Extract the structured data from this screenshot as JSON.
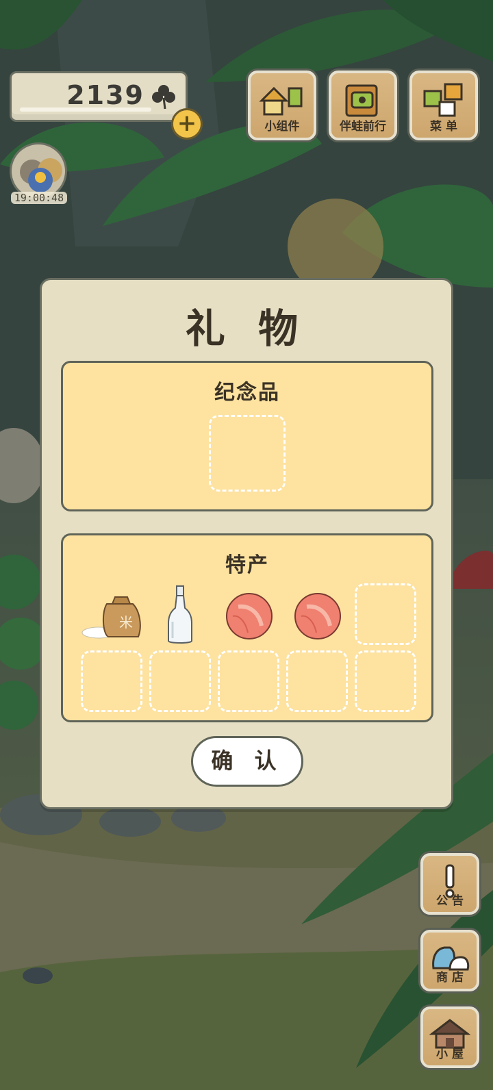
{
  "hud": {
    "clover_count": "2139",
    "add_symbol": "+",
    "timer": "19:00:48"
  },
  "top_buttons": [
    {
      "label": "小组件",
      "icon": "widget-icon"
    },
    {
      "label": "伴蛙前行",
      "icon": "journey-icon"
    },
    {
      "label": "菜 单",
      "icon": "menu-icon"
    }
  ],
  "side_buttons": [
    {
      "label": "公 告",
      "icon": "notice-icon"
    },
    {
      "label": "商 店",
      "icon": "shop-icon"
    },
    {
      "label": "小 屋",
      "icon": "house-icon"
    }
  ],
  "dialog": {
    "title": "礼 物",
    "souvenir_title": "纪念品",
    "specialty_title": "特产",
    "specialty_items": [
      {
        "name": "rice-bag-icon",
        "glyph": "米"
      },
      {
        "name": "bottle-icon"
      },
      {
        "name": "peach-icon"
      },
      {
        "name": "peach-icon"
      }
    ],
    "confirm_label": "确 认"
  },
  "colors": {
    "panel_fill": "#fde2a0",
    "dialog_fill": "#e6dfc3",
    "border": "#5f6458",
    "add_button": "#f3c44a"
  }
}
